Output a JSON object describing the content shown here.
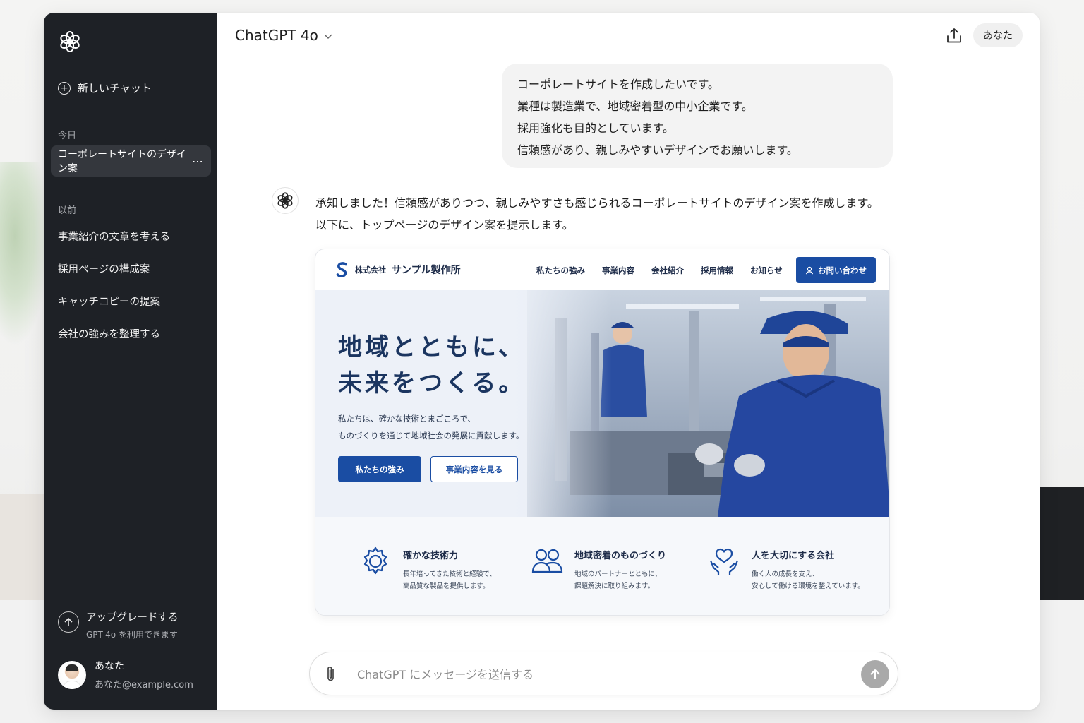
{
  "app": {
    "model_name": "ChatGPT 4o",
    "account_label": "あなた"
  },
  "sidebar": {
    "new_chat": "新しいチャット",
    "today_label": "今日",
    "active_chat": "コーポレートサイトのデザイン案",
    "active_more": "⋯",
    "previous_label": "以前",
    "previous_items": [
      "事業紹介の文章を考える",
      "採用ページの構成案",
      "キャッチコピーの提案",
      "会社の強みを整理する"
    ],
    "upgrade_title": "アップグレードする",
    "upgrade_sub": "GPT-4o を利用できます",
    "user_name": "あなた",
    "user_email": "あなた@example.com"
  },
  "conversation": {
    "user_message": [
      "コーポレートサイトを作成したいです。",
      "業種は製造業で、地域密着型の中小企業です。",
      "採用強化も目的としています。",
      "信頼感があり、親しみやすいデザインでお願いします。"
    ],
    "assistant_message": [
      "承知しました！信頼感がありつつ、親しみやすさも感じられるコーポレートサイトのデザイン案を作成します。",
      "以下に、トップページのデザイン案を提示します。"
    ]
  },
  "mockup": {
    "company_prefix": "株式会社",
    "company_name": "サンプル製作所",
    "nav": [
      "私たちの強み",
      "事業内容",
      "会社紹介",
      "採用情報",
      "お知らせ"
    ],
    "contact_button": "お問い合わせ",
    "hero_title_line1": "地域とともに、",
    "hero_title_line2": "未来をつくる。",
    "hero_sub_line1": "私たちは、確かな技術とまごころで、",
    "hero_sub_line2": "ものづくりを通じて地域社会の発展に貢献します。",
    "hero_button_primary": "私たちの強み",
    "hero_button_secondary": "事業内容を見る",
    "accent_color": "#1a4da3",
    "features": [
      {
        "icon": "gear-icon",
        "title": "確かな技術力",
        "desc1": "長年培ってきた技術と経験で、",
        "desc2": "高品質な製品を提供します。"
      },
      {
        "icon": "people-icon",
        "title": "地域密着のものづくり",
        "desc1": "地域のパートナーとともに、",
        "desc2": "課題解決に取り組みます。"
      },
      {
        "icon": "heart-hands-icon",
        "title": "人を大切にする会社",
        "desc1": "働く人の成長を支え、",
        "desc2": "安心して働ける環境を整えています。"
      }
    ]
  },
  "composer": {
    "placeholder": "ChatGPT にメッセージを送信する"
  }
}
